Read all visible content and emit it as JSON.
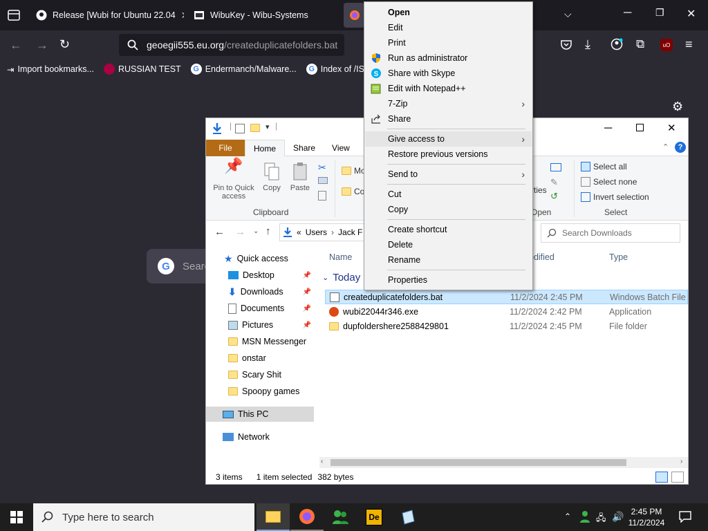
{
  "browser": {
    "tabs": [
      {
        "label": "Release [Wubi for Ubuntu 22.04"
      },
      {
        "label": "WibuKey - Wibu-Systems"
      }
    ],
    "url_domain": "geoegii555.eu.org",
    "url_path": "/createduplicatefolders.bat",
    "bookmarks": [
      {
        "label": "Import bookmarks..."
      },
      {
        "label": "RUSSIAN TEST"
      },
      {
        "label": "Endermanch/Malware..."
      },
      {
        "label": "Index of /ISOs/W"
      }
    ],
    "google_search_placeholder": "Searc"
  },
  "explorer": {
    "ribbon_tabs": [
      "File",
      "Home",
      "Share",
      "View"
    ],
    "clipboard": {
      "pin_label_1": "Pin to Quick",
      "pin_label_2": "access",
      "copy": "Copy",
      "paste": "Paste",
      "group": "Clipboard"
    },
    "organize": {
      "move": "Mo",
      "copy": "Co"
    },
    "open": {
      "properties": "rties",
      "group": "Open"
    },
    "select": {
      "select_all": "Select all",
      "select_none": "Select none",
      "invert": "Invert selection",
      "group": "Select"
    },
    "address": {
      "sep": "«",
      "part1": "Users",
      "part2": "Jack F"
    },
    "search_placeholder": "Search Downloads",
    "nav": {
      "quick_access": "Quick access",
      "items": [
        {
          "label": "Desktop",
          "pinned": true
        },
        {
          "label": "Downloads",
          "pinned": true
        },
        {
          "label": "Documents",
          "pinned": true
        },
        {
          "label": "Pictures",
          "pinned": true
        },
        {
          "label": "MSN Messenger",
          "pinned": false
        },
        {
          "label": "onstar",
          "pinned": false
        },
        {
          "label": "Scary Shit",
          "pinned": false
        },
        {
          "label": "Spoopy games",
          "pinned": false
        }
      ],
      "this_pc": "This PC",
      "network": "Network"
    },
    "columns": {
      "name": "Name",
      "modified": "odified",
      "type": "Type"
    },
    "group_header": "Today",
    "files": [
      {
        "name": "createduplicatefolders.bat",
        "date": "11/2/2024 2:45 PM",
        "type": "Windows Batch File",
        "selected": true
      },
      {
        "name": "wubi22044r346.exe",
        "date": "11/2/2024 2:42 PM",
        "type": "Application",
        "selected": false
      },
      {
        "name": "dupfoldershere2588429801",
        "date": "11/2/2024 2:45 PM",
        "type": "File folder",
        "selected": false
      }
    ],
    "status": {
      "count": "3 items",
      "selected": "1 item selected",
      "size": "382 bytes"
    }
  },
  "context_menu": {
    "items": [
      {
        "label": "Open",
        "bold": true
      },
      {
        "label": "Edit"
      },
      {
        "label": "Print"
      },
      {
        "label": "Run as administrator"
      },
      {
        "label": "Share with Skype"
      },
      {
        "label": "Edit with Notepad++"
      },
      {
        "label": "7-Zip"
      },
      {
        "label": "Share"
      },
      {
        "label": "Give access to"
      },
      {
        "label": "Restore previous versions"
      },
      {
        "label": "Send to"
      },
      {
        "label": "Cut"
      },
      {
        "label": "Copy"
      },
      {
        "label": "Create shortcut"
      },
      {
        "label": "Delete"
      },
      {
        "label": "Rename"
      },
      {
        "label": "Properties"
      }
    ]
  },
  "taskbar": {
    "search_placeholder": "Type here to search",
    "time": "2:45 PM",
    "date": "11/2/2024"
  },
  "colors": {
    "ff_dark": "#1c1b22",
    "ff_toolbar": "#2b2a33",
    "ribbon_file": "#b36c15",
    "selection": "#cce8ff"
  }
}
